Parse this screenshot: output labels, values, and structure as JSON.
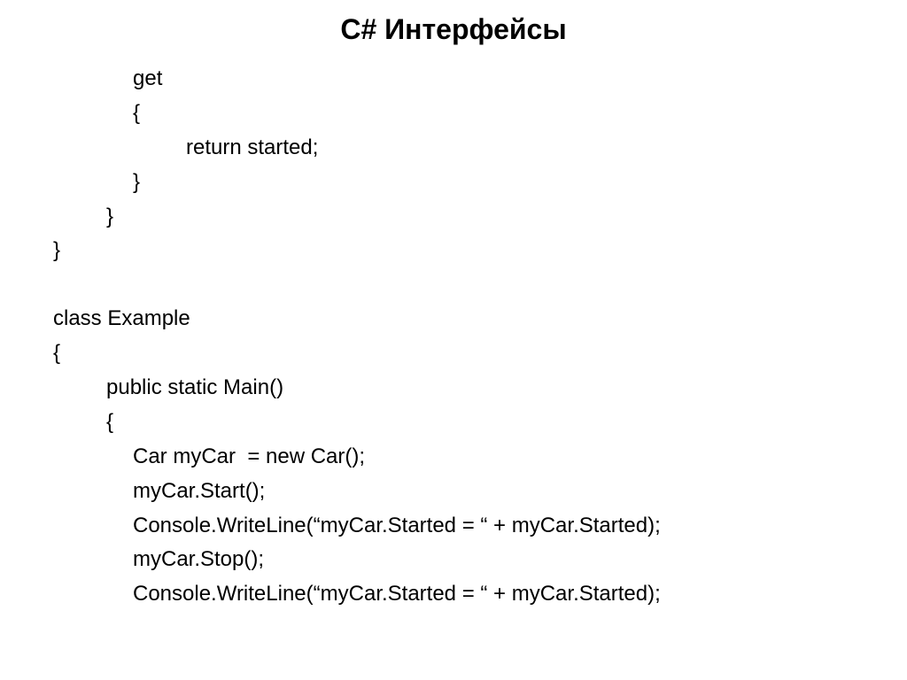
{
  "title": "C#  Интерфейсы",
  "lines": {
    "l1": "get",
    "l2": "{",
    "l3": "return started;",
    "l4": "}",
    "l5": "}",
    "l6": "}",
    "l7": "class Example",
    "l8": "{",
    "l9": "public static Main()",
    "l10": "{",
    "l11": "Car myCar  = new Car();",
    "l12": "myCar.Start();",
    "l13": "Console.WriteLine(“myCar.Started = “ + myCar.Started);",
    "l14": "myCar.Stop();",
    "l15": "Console.WriteLine(“myCar.Started = “ + myCar.Started);"
  }
}
